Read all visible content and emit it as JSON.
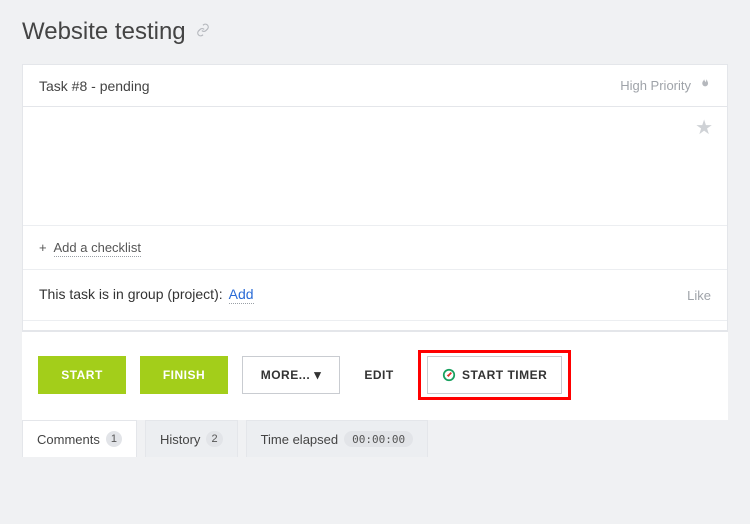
{
  "header": {
    "title": "Website testing"
  },
  "task": {
    "title": "Task #8 - pending",
    "priority_label": "High Priority"
  },
  "checklist": {
    "add_label": "Add a checklist"
  },
  "group": {
    "text": "This task is in group (project):",
    "add_label": "Add"
  },
  "like": {
    "label": "Like"
  },
  "actions": {
    "start": "START",
    "finish": "FINISH",
    "more": "MORE...",
    "edit": "EDIT",
    "start_timer": "START TIMER"
  },
  "tabs": {
    "comments": {
      "label": "Comments",
      "count": "1"
    },
    "history": {
      "label": "History",
      "count": "2"
    },
    "time_elapsed": {
      "label": "Time elapsed",
      "value": "00:00:00"
    }
  }
}
